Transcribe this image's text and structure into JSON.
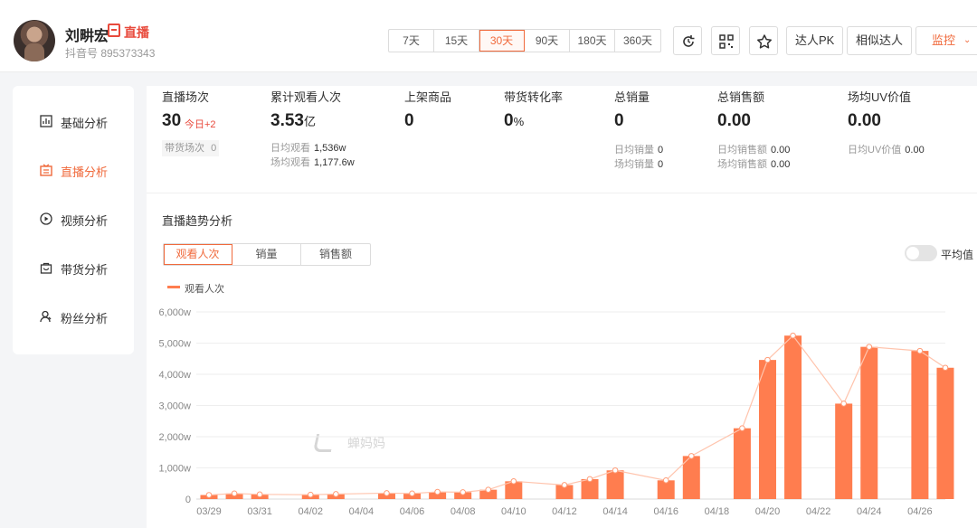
{
  "user": {
    "name": "刘畊宏",
    "live_tag": "直播",
    "douyin_id": "抖音号 895373343"
  },
  "range": {
    "options": [
      "7天",
      "15天",
      "30天",
      "90天",
      "180天",
      "360天"
    ],
    "selected": "30天"
  },
  "toolbar": {
    "icons": [
      "refresh-icon",
      "qrcode-icon",
      "star-icon"
    ],
    "pk_label": "达人PK",
    "similar_label": "相似达人",
    "monitor_label": "监控"
  },
  "sidebar": {
    "items": [
      {
        "label": "基础分析",
        "icon": "bar-chart-icon",
        "active": false
      },
      {
        "label": "直播分析",
        "icon": "live-icon",
        "active": true
      },
      {
        "label": "视频分析",
        "icon": "play-circle-icon",
        "active": false
      },
      {
        "label": "带货分析",
        "icon": "bag-icon",
        "active": false
      },
      {
        "label": "粉丝分析",
        "icon": "user-icon",
        "active": false
      }
    ]
  },
  "metrics": {
    "live_count": {
      "label": "直播场次",
      "value": "30",
      "today": "今日+2",
      "sub_label": "带货场次",
      "sub_value": "0"
    },
    "total_viewers": {
      "label": "累计观看人次",
      "value": "3.53",
      "unit": "亿",
      "daily_label": "日均观看",
      "daily_value": "1,536w",
      "avg_label": "场均观看",
      "avg_value": "1,177.6w"
    },
    "products": {
      "label": "上架商品",
      "value": "0"
    },
    "conversion": {
      "label": "带货转化率",
      "value": "0",
      "unit": "%"
    },
    "sales": {
      "label": "总销量",
      "value": "0",
      "daily_label": "日均销量",
      "daily_value": "0",
      "avg_label": "场均销量",
      "avg_value": "0"
    },
    "revenue": {
      "label": "总销售额",
      "value": "0.00",
      "daily_label": "日均销售额",
      "daily_value": "0.00",
      "avg_label": "场均销售额",
      "avg_value": "0.00"
    },
    "uv": {
      "label": "场均UV价值",
      "value": "0.00",
      "daily_label": "日均UV价值",
      "daily_value": "0.00"
    }
  },
  "trend": {
    "title": "直播趋势分析",
    "tabs": [
      "观看人次",
      "销量",
      "销售额"
    ],
    "selected_tab": "观看人次",
    "toggle_label": "平均值",
    "toggle_on": false,
    "watermark": "蝉妈妈"
  },
  "colors": {
    "accent": "#f06a3c",
    "bar": "#ff7d4f",
    "red": "#e84a3c"
  },
  "chart_data": {
    "type": "bar",
    "series": [
      {
        "name": "观看人次",
        "values": [
          130,
          180,
          150,
          null,
          140,
          160,
          null,
          190,
          180,
          230,
          220,
          300,
          570,
          null,
          450,
          640,
          920,
          null,
          600,
          1380,
          null,
          2270,
          4460,
          5240,
          null,
          3060,
          4880,
          null,
          4750,
          4210
        ]
      }
    ],
    "categories": [
      "03/29",
      "03/30",
      "03/31",
      "04/01",
      "04/02",
      "04/03",
      "04/04",
      "04/05",
      "04/06",
      "04/07",
      "04/08",
      "04/09",
      "04/10",
      "04/11",
      "04/12",
      "04/13",
      "04/14",
      "04/15",
      "04/16",
      "04/17",
      "04/18",
      "04/19",
      "04/20",
      "04/21",
      "04/22",
      "04/23",
      "04/24",
      "04/25",
      "04/26",
      "04/27"
    ],
    "x_tick_labels": [
      "03/29",
      "03/31",
      "04/02",
      "04/04",
      "04/06",
      "04/08",
      "04/10",
      "04/12",
      "04/14",
      "04/16",
      "04/18",
      "04/20",
      "04/22",
      "04/24",
      "04/26"
    ],
    "y_tick_labels": [
      "0",
      "1,000w",
      "2,000w",
      "3,000w",
      "4,000w",
      "5,000w",
      "6,000w"
    ],
    "ylim": [
      0,
      6000
    ],
    "overlay_line": true,
    "grid": true,
    "legend": "top-left"
  }
}
